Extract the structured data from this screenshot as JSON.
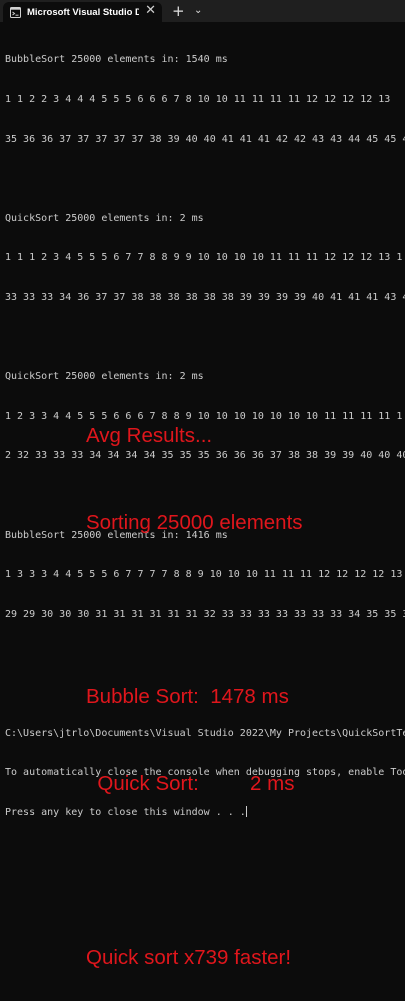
{
  "window": {
    "tab_title": "Microsoft Visual Studio Debu",
    "tab_icon": "terminal-icon",
    "close_glyph": "✕",
    "new_tab_glyph": "+",
    "dropdown_glyph": "⌄"
  },
  "console": {
    "lines": [
      "BubbleSort 25000 elements in: 1540 ms",
      "1 1 2 2 3 4 4 4 5 5 5 6 6 6 7 8 10 10 11 11 11 11 12 12 12 12 13",
      "35 36 36 37 37 37 37 37 38 39 40 40 41 41 41 42 42 43 43 44 45 45 4",
      "",
      "QuickSort 25000 elements in: 2 ms",
      "1 1 1 2 3 4 5 5 5 6 7 7 8 8 9 9 10 10 10 10 11 11 11 12 12 12 13 1",
      "33 33 33 34 36 37 37 38 38 38 38 38 38 39 39 39 39 40 41 41 41 43 4",
      "",
      "QuickSort 25000 elements in: 2 ms",
      "1 2 3 3 4 4 5 5 5 6 6 6 7 8 8 9 10 10 10 10 10 10 10 11 11 11 11 1",
      "2 32 33 33 33 34 34 34 34 35 35 35 36 36 36 37 38 38 39 39 40 40 40",
      "",
      "BubbleSort 25000 elements in: 1416 ms",
      "1 3 3 3 4 4 5 5 5 6 7 7 7 7 8 8 9 10 10 10 11 11 11 12 12 12 12 13",
      "29 29 30 30 30 31 31 31 31 31 31 32 33 33 33 33 33 33 33 34 35 35 3",
      "",
      "",
      "C:\\Users\\jtrlo\\Documents\\Visual Studio 2022\\My Projects\\QuickSortTe",
      "To automatically close the console when debugging stops, enable Too",
      "Press any key to close this window . . ."
    ]
  },
  "overlay": {
    "line1": "Avg Results...",
    "line2": "Sorting 25000 elements",
    "line3": "",
    "line4": "Bubble Sort:  1478 ms",
    "line5": "  Quick Sort:         2 ms",
    "line6": "",
    "line7": "Quick sort x739 faster!"
  }
}
